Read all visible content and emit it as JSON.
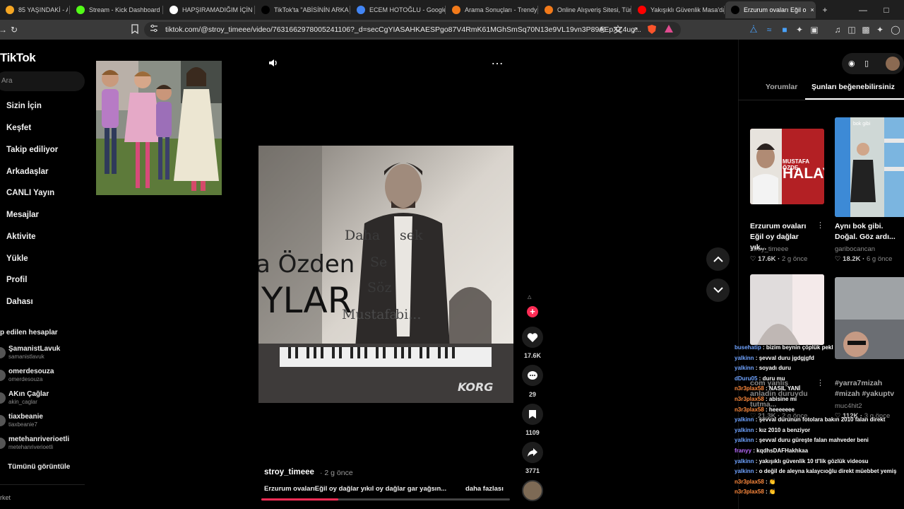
{
  "browser": {
    "tabs": [
      {
        "label": "85 YAŞINDAKİ - Arama",
        "fav": "#f5a623"
      },
      {
        "label": "Stream - Kick Dashboard",
        "fav": "#53fc18"
      },
      {
        "label": "HAPŞIRAMADIĞIM İÇİN Ö",
        "fav": "#ffffff"
      },
      {
        "label": "TikTok'ta \"ABİSİNİN ARKA",
        "fav": "#000000"
      },
      {
        "label": "ECEM HOTOĞLU - Google",
        "fav": "#4285f4"
      },
      {
        "label": "Arama Sonuçları - Trendy",
        "fav": "#f27a1a"
      },
      {
        "label": "Online Alışveriş Sitesi, Tür",
        "fav": "#f27a1a"
      },
      {
        "label": "Yakışıklı Güvenlik Masa'da",
        "fav": "#ff0000"
      },
      {
        "label": "Erzurum ovaları Eğil o",
        "fav": "#000000"
      }
    ],
    "url": "tiktok.com/@stroy_timeee/video/7631662978005241106?_d=secCgYIASAHKAESPgo87V4RmK61MGhSmSq70N13e9VL19vn3P89AEpXZ4ug...",
    "new_tab": "+",
    "close_tab": "×"
  },
  "sidebar": {
    "logo": "TikTok",
    "search_placeholder": "Ara",
    "nav": [
      "Sizin İçin",
      "Keşfet",
      "Takip ediliyor",
      "Arkadaşlar",
      "CANLI Yayın",
      "Mesajlar",
      "Aktivite",
      "Yükle",
      "Profil",
      "Dahası"
    ],
    "following_title": "p edilen hesaplar",
    "accounts": [
      {
        "name": "ŞamanistLavuk",
        "handle": "samanistlavuk"
      },
      {
        "name": "omerdesouza",
        "handle": "omerdesouza"
      },
      {
        "name": "AKın Çağlar",
        "handle": "akin_caglar"
      },
      {
        "name": "tiaxbeanie",
        "handle": "tiaxbeanie7"
      },
      {
        "name": "metehanriverioetli",
        "handle": "metehanriverioetli"
      }
    ],
    "see_all": "Tümünü görüntüle",
    "footer": "rket"
  },
  "video": {
    "overlay_lines": [
      "Daha",
      "sek",
      "Se",
      "Söz",
      "Mustafa",
      "bi..."
    ],
    "name_text": "a Özden",
    "big_text": "YLAR",
    "brand": "KORG",
    "author": "stroy_timeee",
    "posted": "· 2 g önce",
    "caption": "Erzurum ovalarıEğil oy dağlar yıkıl oy dağlar gar yağsın...",
    "more": "daha fazlası",
    "progress": 0.31
  },
  "actions": {
    "likes": "17.6K",
    "comments": "29",
    "saves": "1109",
    "shares": "3771"
  },
  "right_panel": {
    "tabs": [
      "Yorumlar",
      "Şunları beğenebilirsiniz"
    ],
    "cards": [
      {
        "title": "Erzurum ovaları Eğil oy dağlar yık...",
        "user": "stroy_timeee",
        "likes": "17.6K",
        "ago": "2 g önce",
        "img_text": "HALAY",
        "img_sub": "MUSTAFA ÖZDE"
      },
      {
        "title": "Aynı bok gibi. Doğal. Göz ardı...",
        "user": "garibocancan",
        "likes": "18.2K",
        "ago": "6 g önce",
        "img_text": "bok gibi"
      },
      {
        "title": "com yanlış anladin duruydu tutma...",
        "user": "",
        "likes": "21.3K",
        "ago": "2 g önce",
        "img_text": ""
      },
      {
        "title": "#yarra7mizah #mizah #yakuptv",
        "user": "muc4hit2",
        "likes": "112K",
        "ago": "3 g önce",
        "img_text": ""
      }
    ]
  },
  "chat": [
    {
      "user": "busehatip",
      "msg": "bizim beynin çöplük pekl",
      "color": "#6fa3ff"
    },
    {
      "user": "yalkinn",
      "msg": "şevval duru jgdgjgfd",
      "color": "#6fa3ff"
    },
    {
      "user": "yalkinn",
      "msg": "soyadı duru",
      "color": "#6fa3ff"
    },
    {
      "user": "dDuru05",
      "msg": "duru mu",
      "color": "#6fa3ff"
    },
    {
      "user": "n3r3plax58",
      "msg": "NASIL YANİ",
      "color": "#ff8a3d"
    },
    {
      "user": "n3r3plax58",
      "msg": "abisine mi",
      "color": "#ff8a3d"
    },
    {
      "user": "n3r3plax58",
      "msg": "heeeeeee",
      "color": "#ff8a3d"
    },
    {
      "user": "yalkinn",
      "msg": "şevval durunun fotolara bakın 2010 falan direkt",
      "color": "#6fa3ff"
    },
    {
      "user": "yalkinn",
      "msg": "kız 2010 a benziyor",
      "color": "#6fa3ff"
    },
    {
      "user": "yalkinn",
      "msg": "şevval duru güreşte falan mahveder beni",
      "color": "#6fa3ff"
    },
    {
      "user": "franyy",
      "msg": "kqdhsDAFHakhkaa",
      "color": "#b86bff"
    },
    {
      "user": "yalkinn",
      "msg": "yakışıklı güvenlik 10 tl'lik gözlük videosu",
      "color": "#6fa3ff"
    },
    {
      "user": "yalkinn",
      "msg": "o değil de aleyna kalaycıoğlu direkt müebbet yemiş",
      "color": "#6fa3ff"
    },
    {
      "user": "n3r3plax58",
      "msg": "👏",
      "color": "#ff8a3d"
    },
    {
      "user": "n3r3plax58",
      "msg": "👏",
      "color": "#ff8a3d"
    }
  ]
}
